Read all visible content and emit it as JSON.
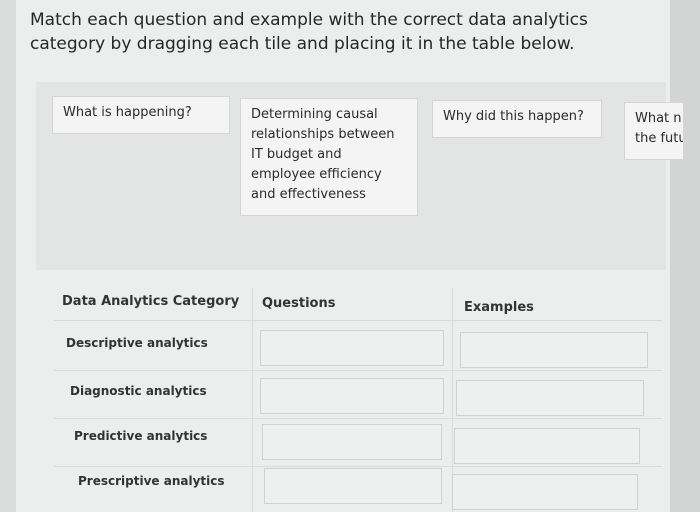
{
  "instructions": "Match each question and example with the correct data analytics category by dragging each tile and placing it in the table below.",
  "tiles": [
    {
      "text": "What is happening?"
    },
    {
      "text": "Determining causal relationships between IT budget and employee efficiency and effectiveness"
    },
    {
      "text": "Why did this happen?"
    },
    {
      "text": "What n the futu"
    }
  ],
  "table": {
    "headers": {
      "category": "Data Analytics Category",
      "questions": "Questions",
      "examples": "Examples"
    },
    "rows": [
      {
        "category": "Descriptive analytics"
      },
      {
        "category": "Diagnostic analytics"
      },
      {
        "category": "Predictive analytics"
      },
      {
        "category": "Prescriptive analytics"
      }
    ]
  }
}
